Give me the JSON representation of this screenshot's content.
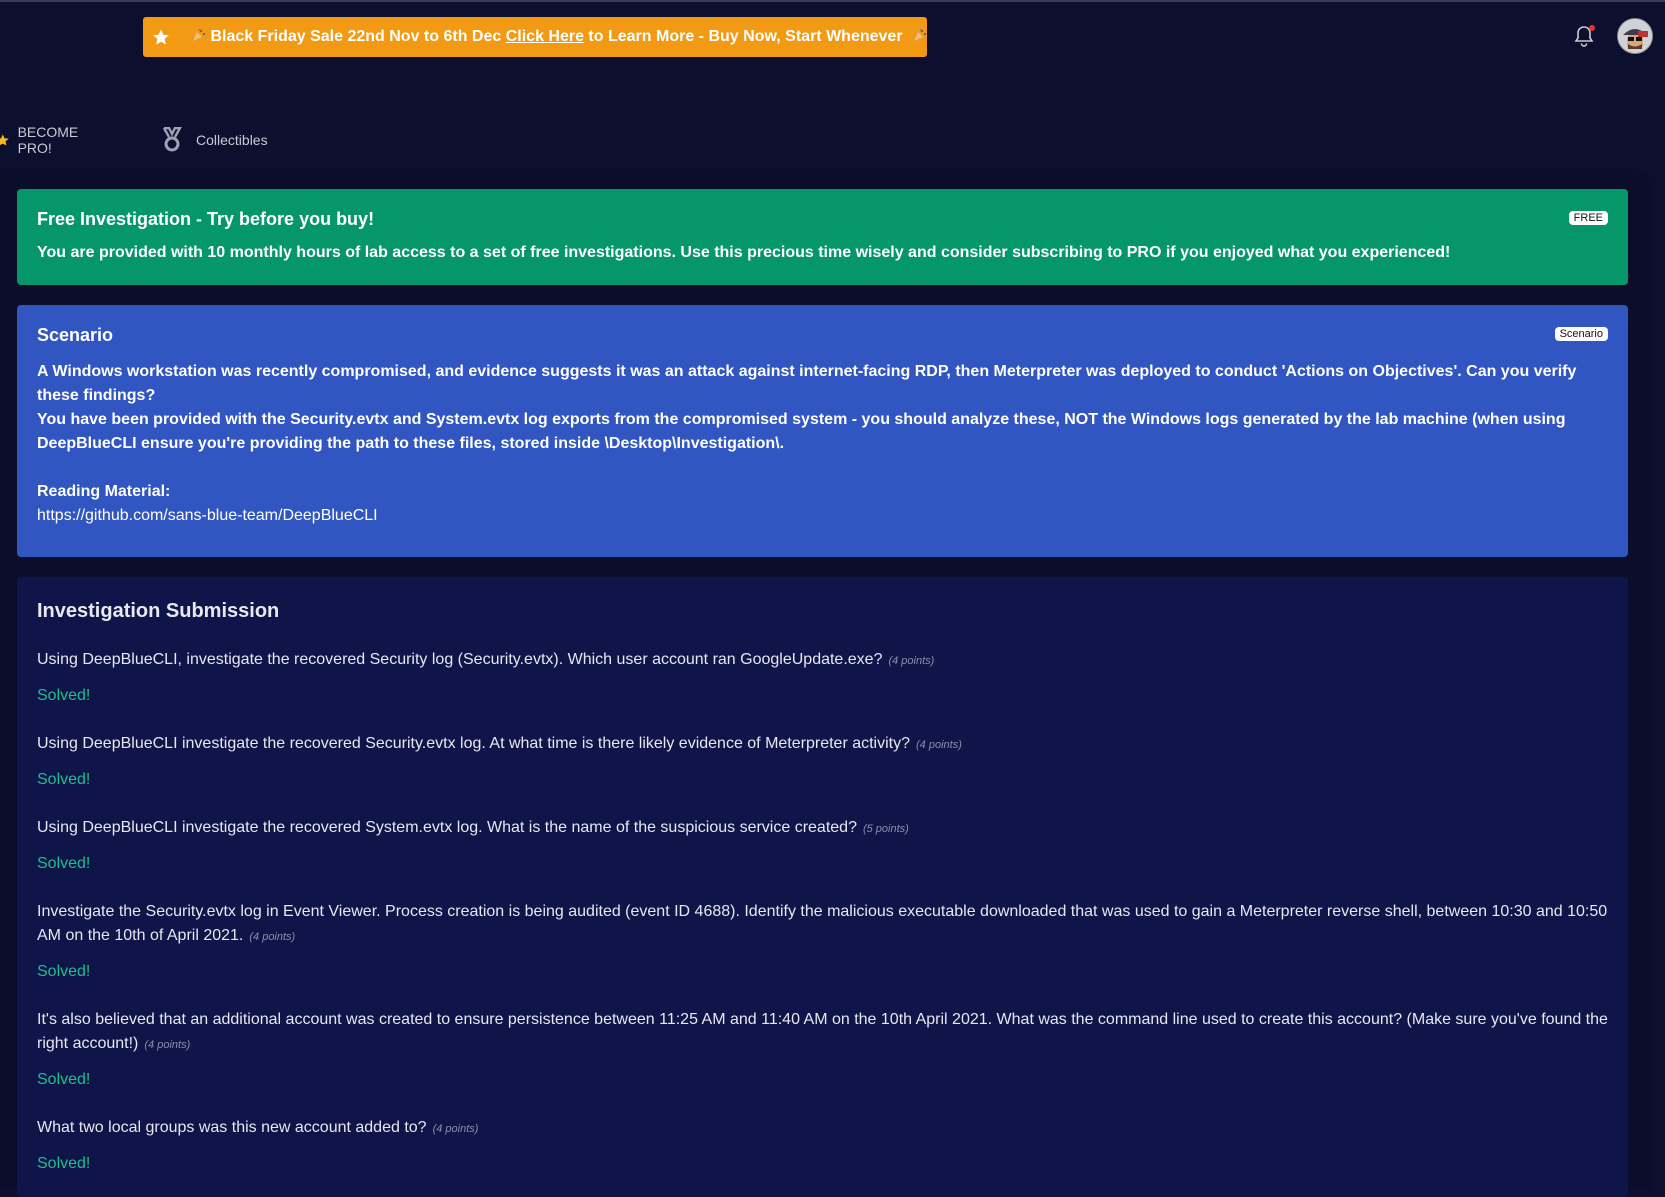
{
  "banner": {
    "prefix": "Black Friday Sale 22nd Nov to 6th Dec ",
    "link": "Click Here",
    "suffix": " to Learn More - Buy Now, Start Whenever",
    "color": "#f29a13"
  },
  "header": {
    "notification_icon": "bell-icon",
    "avatar_icon": "user-avatar"
  },
  "nav": {
    "pro_label": "BECOME PRO!",
    "collectibles_label": "Collectibles"
  },
  "free_card": {
    "title": "Free Investigation - Try before you buy!",
    "badge": "FREE",
    "text": "You are provided with 10 monthly hours of lab access to a set of free investigations. Use this precious time wisely and consider subscribing to PRO if you enjoyed what you experienced!",
    "color": "#05966a"
  },
  "scenario": {
    "title": "Scenario",
    "badge": "Scenario",
    "para1": "A Windows workstation was recently compromised, and evidence suggests it was an attack against internet-facing RDP, then Meterpreter was deployed to conduct 'Actions on Objectives'. Can you verify these findings?",
    "para2": "You have been provided with the Security.evtx and System.evtx log exports from the compromised system - you should analyze these, NOT the Windows logs generated by the lab machine (when using DeepBlueCLI ensure you're providing the path to these files, stored inside \\Desktop\\Investigation\\.",
    "reading_label": "Reading Material:",
    "reading_link": "https://github.com/sans-blue-team/DeepBlueCLI",
    "color": "#3155c1"
  },
  "investigation": {
    "title": "Investigation Submission",
    "questions": [
      {
        "text": "Using DeepBlueCLI, investigate the recovered Security log (Security.evtx). Which user account ran GoogleUpdate.exe?",
        "points": "(4 points)",
        "status": "Solved!"
      },
      {
        "text": "Using DeepBlueCLI investigate the recovered Security.evtx log. At what time is there likely evidence of Meterpreter activity?",
        "points": "(4 points)",
        "status": "Solved!"
      },
      {
        "text": "Using DeepBlueCLI investigate the recovered System.evtx log. What is the name of the suspicious service created?",
        "points": "(5 points)",
        "status": "Solved!"
      },
      {
        "text": "Investigate the Security.evtx log in Event Viewer. Process creation is being audited (event ID 4688). Identify the malicious executable downloaded that was used to gain a Meterpreter reverse shell, between 10:30 and 10:50 AM on the 10th of April 2021.",
        "points": "(4 points)",
        "status": "Solved!"
      },
      {
        "text": "It's also believed that an additional account was created to ensure persistence between 11:25 AM and 11:40 AM on the 10th April 2021. What was the command line used to create this account? (Make sure you've found the right account!)",
        "points": "(4 points)",
        "status": "Solved!"
      },
      {
        "text": "What two local groups was this new account added to?",
        "points": "(4 points)",
        "status": "Solved!"
      }
    ],
    "solved_color": "#1fbf8f"
  }
}
